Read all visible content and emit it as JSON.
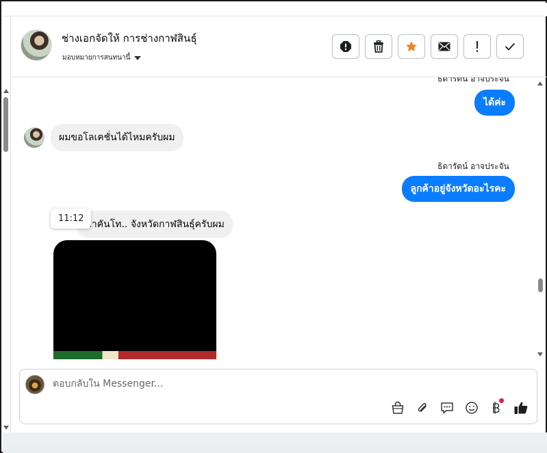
{
  "header": {
    "contact_name": "ช่างเอกจัดให้ การช่างกาฬสินธุ์",
    "assign_label": "มอบหมายการสนทนานี้",
    "actions": [
      {
        "name": "report-button",
        "icon": "alert-circle-icon"
      },
      {
        "name": "delete-button",
        "icon": "trash-icon"
      },
      {
        "name": "star-button",
        "icon": "star-icon"
      },
      {
        "name": "mark-unread-button",
        "icon": "envelope-icon"
      },
      {
        "name": "spam-button",
        "icon": "exclamation-icon"
      },
      {
        "name": "done-button",
        "icon": "checkmark-icon"
      }
    ]
  },
  "messages": [
    {
      "direction": "out",
      "sender": "ธิดารัตน์ อาจประจัน",
      "text": "ได้ค่ะ"
    },
    {
      "direction": "in",
      "text": "ผมขอโลเคชั่นได้ไหมครับผม"
    },
    {
      "direction": "out",
      "sender": "ธิดารัตน์ อาจประจัน",
      "text": "ลูกค้าอยู่จังหวัดอะไรคะ"
    },
    {
      "direction": "in",
      "text": "อำเภอท่าคันโท.. จังหวัดกาฬสินธุ์ครับผม",
      "tooltip": "11:12"
    }
  ],
  "composer": {
    "placeholder": "ตอบกลับใน Messenger..."
  },
  "colors": {
    "accent": "#0a7cff",
    "star": "#f5821f",
    "notification": "#e41e3f"
  }
}
